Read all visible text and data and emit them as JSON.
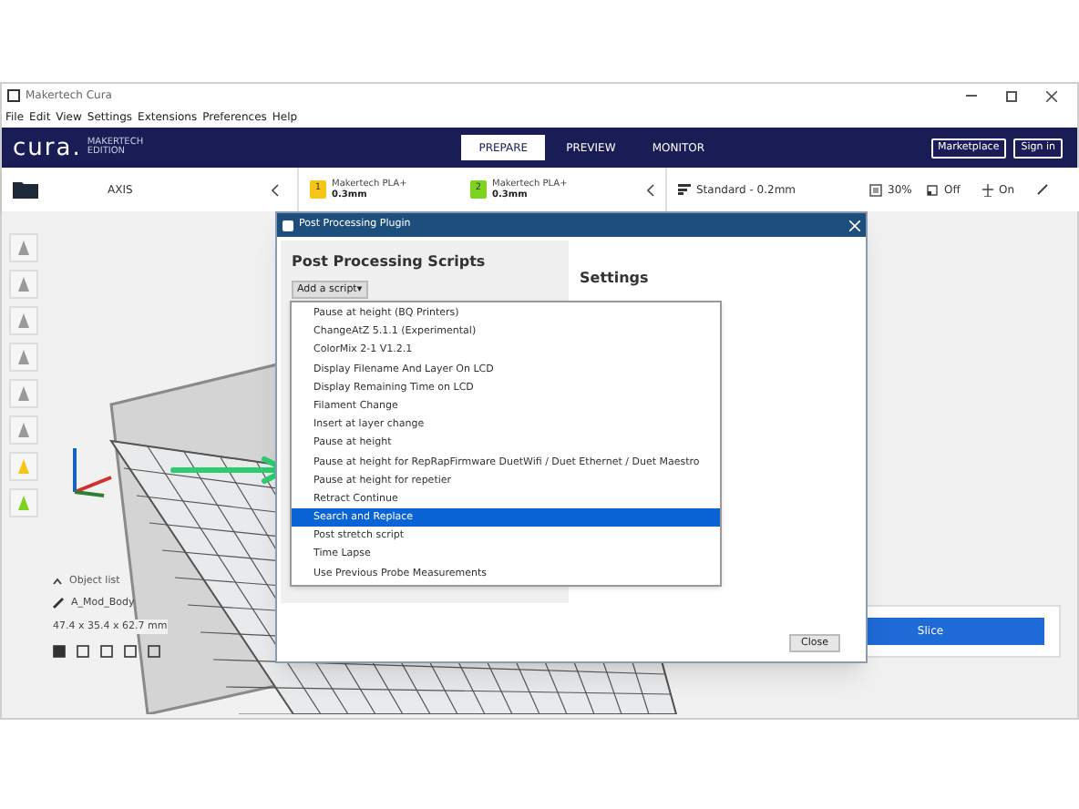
{
  "window": {
    "title": "Makertech Cura"
  },
  "menu": [
    "File",
    "Edit",
    "View",
    "Settings",
    "Extensions",
    "Preferences",
    "Help"
  ],
  "logo": {
    "wordmark": "cura.",
    "edition": "MAKERTECH EDITION"
  },
  "stages": [
    {
      "label": "PREPARE",
      "selected": true
    },
    {
      "label": "PREVIEW",
      "selected": false
    },
    {
      "label": "MONITOR",
      "selected": false
    }
  ],
  "header_buttons": [
    "Marketplace",
    "Sign in"
  ],
  "toolbar": {
    "printer": "AXIS",
    "extruders": [
      {
        "number": "1",
        "material": "Makertech PLA+",
        "nozzle": "0.3mm",
        "color": "#f5c518"
      },
      {
        "number": "2",
        "material": "Makertech PLA+",
        "nozzle": "0.3mm",
        "color": "#7ed321"
      }
    ],
    "profile": "Standard - 0.2mm",
    "infill": "30%",
    "support": "Off",
    "adhesion": "On"
  },
  "dialog": {
    "title": "Post Processing Plugin",
    "scripts_heading": "Post Processing Scripts",
    "add_button": "Add a script▾",
    "settings_heading": "Settings",
    "close_button": "Close",
    "scripts": [
      {
        "label": "Pause at height (BQ Printers)",
        "selected": false
      },
      {
        "label": "ChangeAtZ 5.1.1 (Experimental)",
        "selected": false
      },
      {
        "label": "ColorMix 2-1 V1.2.1",
        "selected": false
      },
      {
        "label": "Display Filename And Layer On LCD",
        "selected": false
      },
      {
        "label": "Display Remaining Time on LCD",
        "selected": false
      },
      {
        "label": "Filament Change",
        "selected": false
      },
      {
        "label": "Insert at layer change",
        "selected": false
      },
      {
        "label": "Pause at height",
        "selected": false
      },
      {
        "label": "Pause at height for RepRapFirmware DuetWifi / Duet Ethernet / Duet Maestro",
        "selected": false
      },
      {
        "label": "Pause at height for repetier",
        "selected": false
      },
      {
        "label": "Retract Continue",
        "selected": false
      },
      {
        "label": "Search and Replace",
        "selected": true
      },
      {
        "label": "Post stretch script",
        "selected": false
      },
      {
        "label": "Time Lapse",
        "selected": false
      },
      {
        "label": "Use Previous Probe Measurements",
        "selected": false
      }
    ]
  },
  "object_panel": {
    "heading": "Object list",
    "object_name": "A_Mod_Body",
    "dimensions": "47.4 x 35.4 x 62.7 mm"
  },
  "slice_button": "Slice"
}
